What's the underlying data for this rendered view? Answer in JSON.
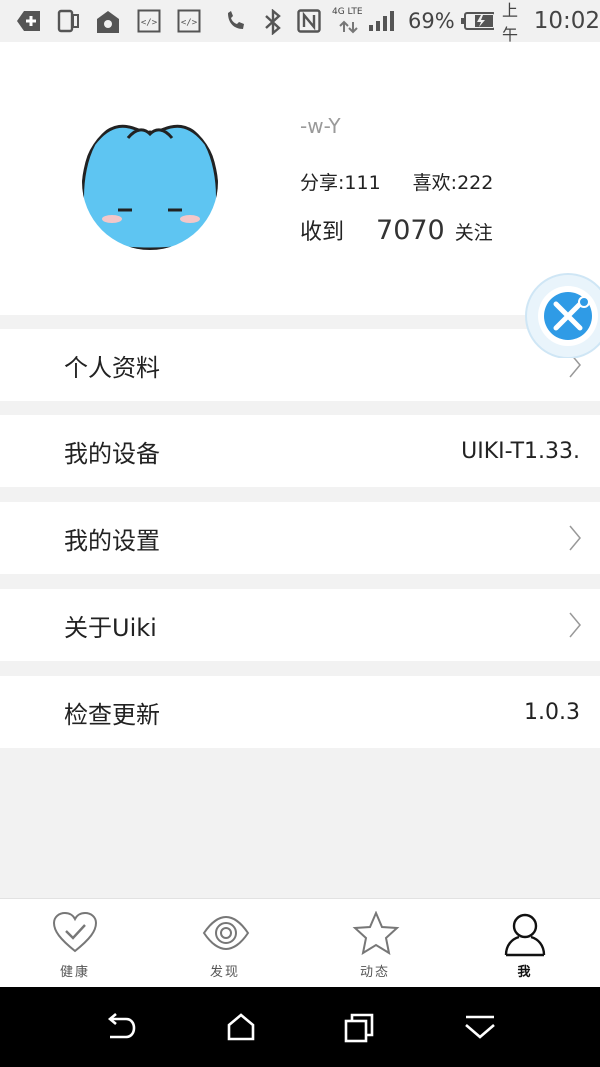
{
  "status_bar": {
    "network_label": "4G LTE",
    "battery_percent": "69%",
    "time_period": "上午",
    "time": "10:02",
    "icons": [
      "add-box-icon",
      "phone-screen-icon",
      "location-icon",
      "code-icon",
      "code-icon",
      "phone-call-icon",
      "bluetooth-icon",
      "nfc-icon",
      "signal-icon",
      "battery-charging-icon"
    ]
  },
  "profile": {
    "username": "-w-Y",
    "shares": "分享:111",
    "likes": "喜欢:222",
    "received_label": "收到",
    "received_count": "7070",
    "received_unit": "关注"
  },
  "menu": {
    "personal_info": "个人资料",
    "my_device": "我的设备",
    "my_device_value": "UIKI-T1.33.",
    "my_settings": "我的设置",
    "about": "关于Uiki",
    "check_update": "检查更新",
    "version": "1.0.3"
  },
  "tabs": [
    {
      "label": "健康",
      "icon": "heart-check-icon"
    },
    {
      "label": "发现",
      "icon": "eye-icon"
    },
    {
      "label": "动态",
      "icon": "star-icon"
    },
    {
      "label": "我",
      "icon": "person-icon"
    }
  ],
  "colors": {
    "accent_blue": "#2f9be6",
    "avatar_blue": "#5ec5f2"
  }
}
